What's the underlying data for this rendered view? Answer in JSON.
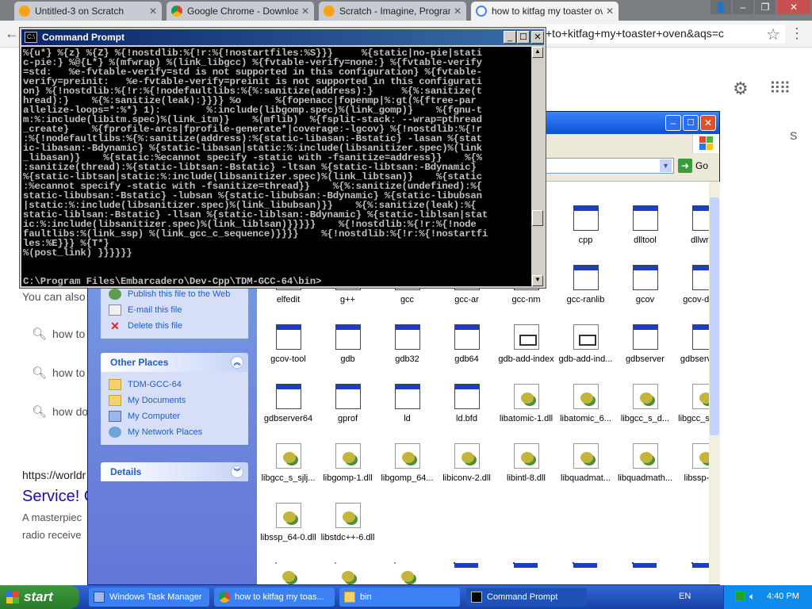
{
  "chrome": {
    "tabs": [
      {
        "label": "Untitled-3 on Scratch",
        "icon": "scratch-icon"
      },
      {
        "label": "Google Chrome - Download t",
        "icon": "chrome-icon"
      },
      {
        "label": "Scratch - Imagine, Program,",
        "icon": "scratch-icon"
      },
      {
        "label": "how to kitfag my toaster ove",
        "icon": "google-icon"
      }
    ],
    "omnibox_text": "+to+kitfag+my+toaster+oven&aqs=c"
  },
  "google": {
    "snippet_you_can": "You can also",
    "suggestions": [
      "how to",
      "how to",
      "how do"
    ],
    "result_url": "https://worldr",
    "result_title": "Service! C",
    "result_snippet_1": "A masterpiec",
    "result_snippet_2": "radio receive",
    "s_letter": "S"
  },
  "explorer": {
    "go_label": "Go",
    "file_tasks": [
      "Publish this file to the Web",
      "E-mail this file",
      "Delete this file"
    ],
    "other_places_title": "Other Places",
    "other_places": [
      "TDM-GCC-64",
      "My Documents",
      "My Computer",
      "My Network Places"
    ],
    "details_title": "Details",
    "files": [
      {
        "name": "cpp",
        "type": "app"
      },
      {
        "name": "dlltool",
        "type": "app"
      },
      {
        "name": "dllwrap",
        "type": "app"
      },
      {
        "name": "elfedit",
        "type": "app"
      },
      {
        "name": "g++",
        "type": "app"
      },
      {
        "name": "gcc",
        "type": "app"
      },
      {
        "name": "gcc-ar",
        "type": "app"
      },
      {
        "name": "gcc-nm",
        "type": "app"
      },
      {
        "name": "gcc-ranlib",
        "type": "app"
      },
      {
        "name": "gcov",
        "type": "app"
      },
      {
        "name": "gcov-dump",
        "type": "app"
      },
      {
        "name": "gcov-tool",
        "type": "app"
      },
      {
        "name": "gdb",
        "type": "app"
      },
      {
        "name": "gdb32",
        "type": "app"
      },
      {
        "name": "gdb64",
        "type": "app"
      },
      {
        "name": "gdb-add-index",
        "type": "doc"
      },
      {
        "name": "gdb-add-ind...",
        "type": "doc"
      },
      {
        "name": "gdbserver",
        "type": "app"
      },
      {
        "name": "gdbserver32",
        "type": "app"
      },
      {
        "name": "gdbserver64",
        "type": "app"
      },
      {
        "name": "gprof",
        "type": "app"
      },
      {
        "name": "ld",
        "type": "app"
      },
      {
        "name": "ld.bfd",
        "type": "app"
      },
      {
        "name": "libatomic-1.dll",
        "type": "dll"
      },
      {
        "name": "libatomic_6...",
        "type": "dll"
      },
      {
        "name": "libgcc_s_d...",
        "type": "dll"
      },
      {
        "name": "libgcc_s_se...",
        "type": "dll"
      },
      {
        "name": "libgcc_s_sjlj...",
        "type": "dll"
      },
      {
        "name": "libgomp-1.dll",
        "type": "dll"
      },
      {
        "name": "libgomp_64...",
        "type": "dll"
      },
      {
        "name": "libiconv-2.dll",
        "type": "dll"
      },
      {
        "name": "libintl-8.dll",
        "type": "dll"
      },
      {
        "name": "libquadmat...",
        "type": "dll"
      },
      {
        "name": "libquadmath...",
        "type": "dll"
      },
      {
        "name": "libssp-0.dll",
        "type": "dll"
      },
      {
        "name": "libssp_64-0.dll",
        "type": "dll"
      },
      {
        "name": "libstdc++-6.dll",
        "type": "dll"
      }
    ]
  },
  "cmd": {
    "title": "Command Prompt",
    "text": "%{u*} %{z} %{Z} %{!nostdlib:%{!r:%{!nostartfiles:%S}}}     %{static|no-pie|stati\nc-pie:} %@{L*} %(mfwrap) %(link_libgcc) %{fvtable-verify=none:} %{fvtable-verify\n=std:   %e-fvtable-verify=std is not supported in this configuration} %{fvtable-\nverify=preinit:   %e-fvtable-verify=preinit is not supported in this configurati\non} %{!nostdlib:%{!r:%{!nodefaultlibs:%{%:sanitize(address):}     %{%:sanitize(t\nhread):}    %{%:sanitize(leak):}}}} %o      %{fopenacc|fopenmp|%:gt(%{ftree-par\nallelize-loops=*:%*} 1):        %:include(libgomp.spec)%(link_gomp)}    %{fgnu-t\nm:%:include(libitm.spec)%(link_itm)}    %(mflib)  %{fsplit-stack: --wrap=pthread\n_create}    %{fprofile-arcs|fprofile-generate*|coverage:-lgcov} %{!nostdlib:%{!r\n:%{!nodefaultlibs:%{%:sanitize(address):%{static-libasan:-Bstatic} -lasan %{stat\nic-libasan:-Bdynamic} %{static-libasan|static:%:include(libsanitizer.spec)%(link\n_libasan)}    %{static:%ecannot specify -static with -fsanitize=address}}    %{%\n:sanitize(thread):%{static-libtsan:-Bstatic} -ltsan %{static-libtsan:-Bdynamic}\n%{static-libtsan|static:%:include(libsanitizer.spec)%(link_libtsan)}    %{static\n:%ecannot specify -static with -fsanitize=thread}}    %{%:sanitize(undefined):%{\nstatic-libubsan:-Bstatic} -lubsan %{static-libubsan:-Bdynamic} %{static-libubsan\n|static:%:include(libsanitizer.spec)%(link_libubsan)}}    %{%:sanitize(leak):%{\nstatic-liblsan:-Bstatic} -llsan %{static-liblsan:-Bdynamic} %{static-liblsan|stat\nic:%:include(libsanitizer.spec)%(link_liblsan)}}}}}    %{!nostdlib:%{!r:%{!node\nfaultlibs:%(link_ssp) %(link_gcc_c_sequence)}}}}    %{!nostdlib:%{!r:%{!nostartfi\nles:%E}}} %{T*}\n%(post_link) }}}}}}\n\n\nC:\\Program Files\\Embarcadero\\Dev-Cpp\\TDM-GCC-64\\bin>"
  },
  "taskbar": {
    "start_label": "start",
    "tasks": [
      {
        "label": "Windows Task Manager",
        "icon": "task-manager-icon"
      },
      {
        "label": "how to kitfag my toas...",
        "icon": "chrome-icon"
      },
      {
        "label": "bin",
        "icon": "folder-icon"
      },
      {
        "label": "Command Prompt",
        "icon": "cmd-icon"
      }
    ],
    "language": "EN",
    "clock": "4:40 PM"
  }
}
